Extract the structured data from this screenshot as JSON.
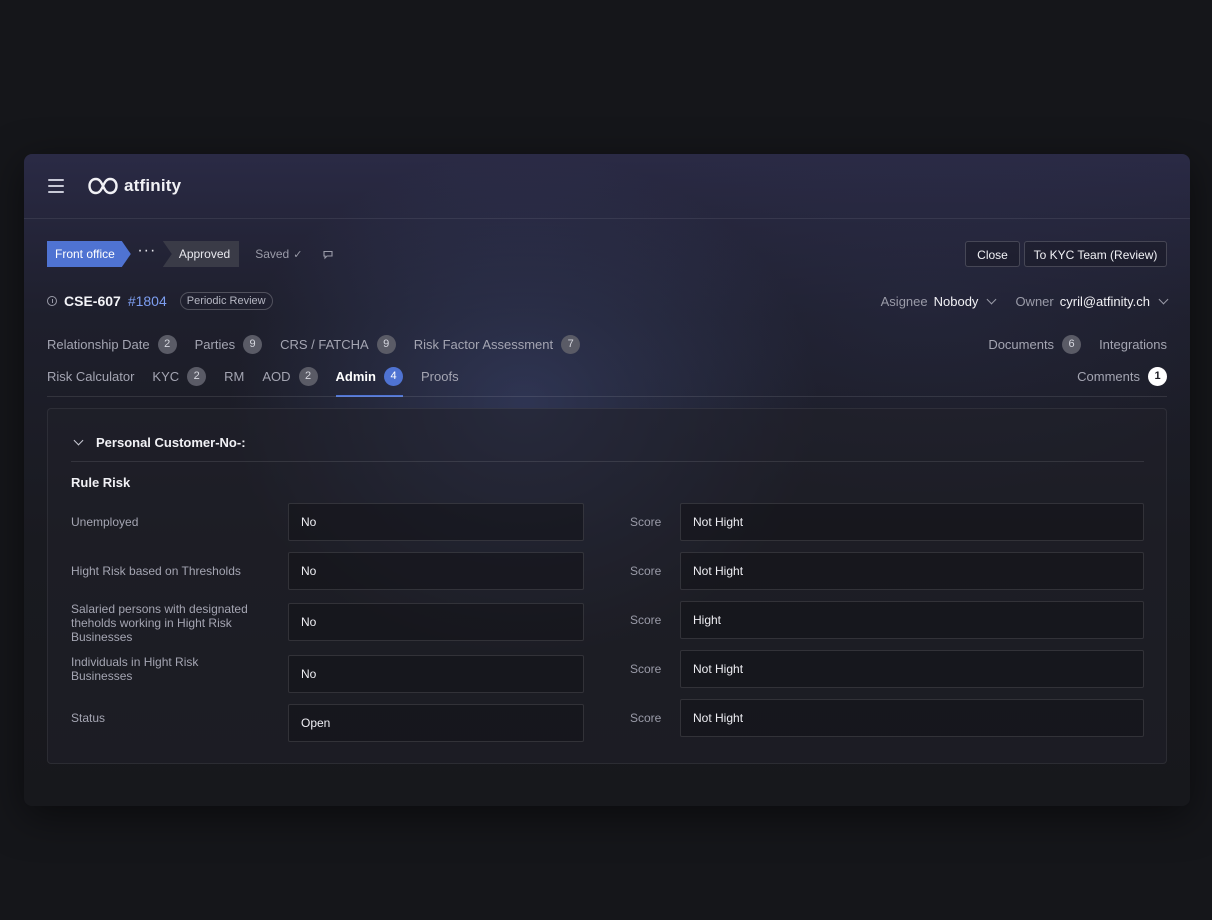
{
  "app": {
    "brand": "atfinity"
  },
  "breadcrumb": {
    "front": "Front office",
    "dots": "···",
    "status": "Approved",
    "saved": "Saved"
  },
  "actions": {
    "close": "Close",
    "kyc": "To KYC Team (Review)"
  },
  "case": {
    "id": "CSE-607",
    "number": "#1804",
    "type": "Periodic Review",
    "assignee_label": "Asignee",
    "assignee": "Nobody",
    "owner_label": "Owner",
    "owner": "cyril@atfinity.ch"
  },
  "tabs_row1": [
    {
      "label": "Relationship Date",
      "count": "2"
    },
    {
      "label": "Parties",
      "count": "9"
    },
    {
      "label": "CRS / FATCHA",
      "count": "9"
    },
    {
      "label": "Risk Factor Assessment",
      "count": "7"
    }
  ],
  "tabs_row1_right": [
    {
      "label": "Documents",
      "count": "6"
    },
    {
      "label": "Integrations"
    }
  ],
  "tabs_row2": [
    {
      "label": "Risk Calculator"
    },
    {
      "label": "KYC",
      "count": "2"
    },
    {
      "label": "RM"
    },
    {
      "label": "AOD",
      "count": "2"
    },
    {
      "label": "Admin",
      "count": "4",
      "active": true
    },
    {
      "label": "Proofs"
    }
  ],
  "tabs_row2_right": [
    {
      "label": "Comments",
      "count": "1"
    }
  ],
  "section": {
    "title": "Personal Customer-No-:",
    "subtitle": "Rule Risk",
    "score_label": "Score",
    "rows": [
      {
        "label": "Unemployed",
        "value": "No",
        "score": "Not Hight"
      },
      {
        "label": "Hight Risk based on Thresholds",
        "value": "No",
        "score": "Not Hight"
      },
      {
        "label": "Salaried persons with designated theholds working in Hight Risk Businesses",
        "value": "No",
        "score": "Hight"
      },
      {
        "label": "Individuals in Hight Risk Businesses",
        "value": "No",
        "score": "Not Hight"
      },
      {
        "label": "Status",
        "value": "Open",
        "score": "Not Hight"
      }
    ]
  },
  "colors": {
    "accent": "#4f73d2",
    "link": "#7d9ef0",
    "background": "#15161a"
  }
}
